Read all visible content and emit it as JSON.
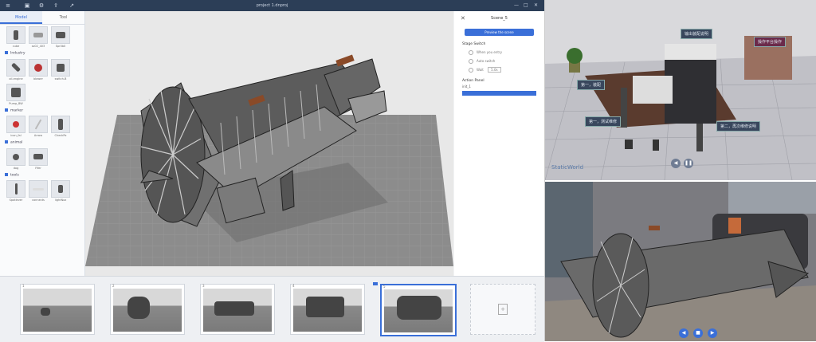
{
  "window": {
    "title": "project 1.dnproj"
  },
  "library": {
    "tabs": [
      "Model",
      "Tool"
    ],
    "categories": [
      {
        "name": "",
        "items": [
          "cube",
          "sz02_403",
          "Spr0b0"
        ]
      },
      {
        "name": "Industry",
        "items": [
          "oil-engine",
          "blower",
          "switch-B"
        ]
      },
      {
        "name": "",
        "items": [
          "Pump_BW"
        ]
      },
      {
        "name": "marker",
        "items": [
          "icon_fal",
          "Arrow",
          "CheckPo"
        ]
      },
      {
        "name": "animal",
        "items": [
          "dog",
          "Fifer"
        ]
      },
      {
        "name": "tools",
        "items": [
          "Spotlever",
          "connects",
          "lightNoz"
        ]
      }
    ]
  },
  "properties": {
    "title": "Scene_5",
    "primary_button": "Preview the scene",
    "stage_switch_label": "Stage Switch",
    "stage_options": [
      "When you entry",
      "Auto switch",
      "Wait"
    ],
    "wait_value": "5.0s",
    "action_panel_label": "Action Panel",
    "action_field": "init_1"
  },
  "timeline": {
    "frames": [
      "1",
      "2",
      "3",
      "4",
      "5"
    ],
    "active_frame": 5
  },
  "photo_labels": {
    "top_a": "输出装配说明",
    "top_b": "操作平台操作",
    "side_a": "第一，装配",
    "side_b": "第一，测试维修",
    "side_c": "第二，再次维修说明",
    "brand": "StaticWorld"
  }
}
